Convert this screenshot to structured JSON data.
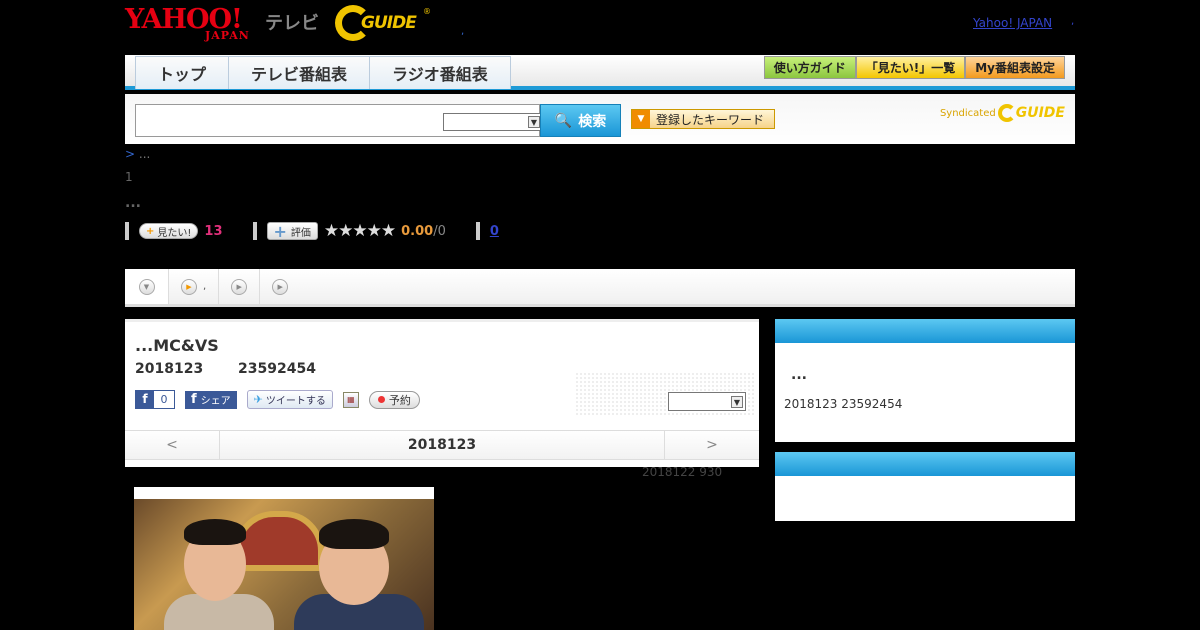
{
  "header": {
    "yahoo_logo": "YAHOO!",
    "yahoo_sub": "JAPAN",
    "tv_label": "テレビ",
    "gguide_logo": "GUIDE",
    "gguide_reg": "®",
    "dot_mark": ",",
    "yahoo_japan_link": "Yahoo! JAPAN",
    "yahoo_dot": ","
  },
  "nav": {
    "tabs": [
      "トップ",
      "テレビ番組表",
      "ラジオ番組表"
    ],
    "right_buttons": [
      "使い方ガイド",
      "「見たい!」一覧",
      "My番組表設定"
    ]
  },
  "search": {
    "placeholder": "",
    "button_label": "検索",
    "keyword_button": "登録したキーワード",
    "syndicated": "Syndicated",
    "syndicated_logo": "GUIDE"
  },
  "breadcrumb": {
    "arrow": ">",
    "text": "..."
  },
  "page_num": "1",
  "ellipsis": "...",
  "stats": {
    "mitai_label": "見たい!",
    "mitai_count": "13",
    "hyoka_label": "評価",
    "stars": "★★★★★",
    "score": "0.00",
    "score_den": "/0",
    "review_count": "0"
  },
  "subtabs": {
    "tab2_label": ","
  },
  "program": {
    "title": "...MC&VS",
    "date": "2018123",
    "time": "23592454",
    "fb_count": "0",
    "fb_share": "シェア",
    "tweet": "ツイートする",
    "yoyaku": "予約"
  },
  "date_nav": {
    "prev": "<",
    "current": "2018123",
    "next": ">"
  },
  "updated": "2018122  930",
  "sidebar": {
    "box1_title": "...",
    "box1_text": "2018123  23592454"
  },
  "icons": {
    "search": "search-icon",
    "facebook": "facebook-icon",
    "twitter": "twitter-icon",
    "calendar": "calendar-icon"
  },
  "colors": {
    "accent_blue": "#1e9ad6",
    "yahoo_red": "#e60012",
    "gguide_yellow": "#f0c400",
    "pink_count": "#e0307a",
    "score_orange": "#e89a3c"
  }
}
